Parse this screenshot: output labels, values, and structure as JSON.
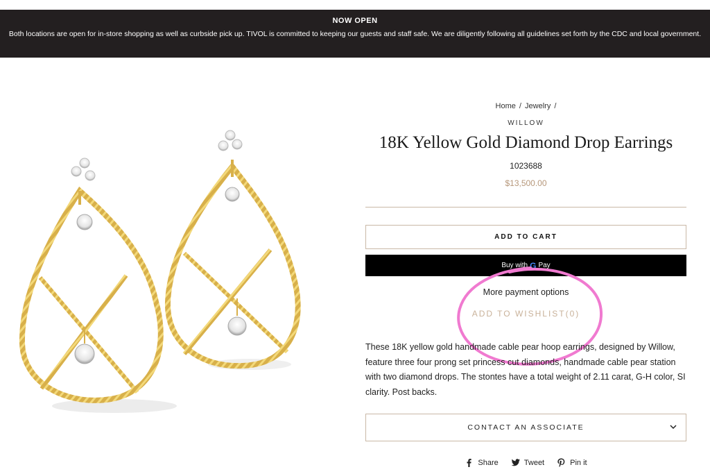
{
  "announcement": {
    "title": "NOW OPEN",
    "text": "Both locations are open for in-store shopping as well as curbside pick up. TIVOL is committed to keeping our guests and staff safe. We are diligently following all guidelines set forth by the CDC and local government."
  },
  "breadcrumb": {
    "home": "Home",
    "separator": "/",
    "jewelry": "Jewelry"
  },
  "product": {
    "vendor": "WILLOW",
    "title": "18K Yellow Gold Diamond Drop Earrings",
    "sku": "1023688",
    "price": "$13,500.00",
    "image_icon": "earrings-image",
    "description": "These 18K yellow gold handmade cable pear hoop earrings, designed by Willow, feature three four prong set princess cut diamonds, handmade cable pear station with two diamond drops. The stontes have a total weight of 2.11 carat, G-H color, SI clarity. Post backs."
  },
  "actions": {
    "add_to_cart": "ADD TO CART",
    "gpay_prefix": "Buy with",
    "gpay_g": "G",
    "gpay_suffix": "Pay",
    "more_payment": "More payment options",
    "wishlist": "ADD TO WISHLIST(0)",
    "contact": "CONTACT AN ASSOCIATE"
  },
  "share": {
    "facebook": "Share",
    "twitter": "Tweet",
    "pinterest": "Pin it"
  },
  "colors": {
    "announcement_bg": "#231f20",
    "price": "#b6977a",
    "border": "#c9b8a6",
    "wishlist": "#c9b29a",
    "highlight_circle": "#f07ad0",
    "gold": "#d8b04a"
  }
}
